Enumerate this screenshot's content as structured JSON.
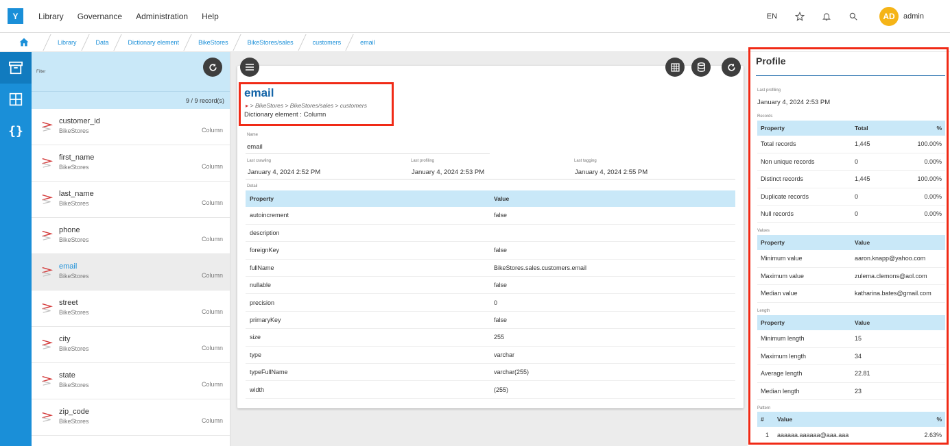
{
  "topbar": {
    "logo": "Y",
    "menu": [
      "Library",
      "Governance",
      "Administration",
      "Help"
    ],
    "lang": "EN",
    "avatar_initials": "AD",
    "username": "admin"
  },
  "breadcrumb": [
    "Library",
    "Data",
    "Dictionary element",
    "BikeStores",
    "BikeStores/sales",
    "customers",
    "email"
  ],
  "list": {
    "filter_label": "Filter",
    "count": "9 / 9 record(s)",
    "items": [
      {
        "name": "customer_id",
        "sub": "BikeStores",
        "type": "Column"
      },
      {
        "name": "first_name",
        "sub": "BikeStores",
        "type": "Column"
      },
      {
        "name": "last_name",
        "sub": "BikeStores",
        "type": "Column"
      },
      {
        "name": "phone",
        "sub": "BikeStores",
        "type": "Column"
      },
      {
        "name": "email",
        "sub": "BikeStores",
        "type": "Column"
      },
      {
        "name": "street",
        "sub": "BikeStores",
        "type": "Column"
      },
      {
        "name": "city",
        "sub": "BikeStores",
        "type": "Column"
      },
      {
        "name": "state",
        "sub": "BikeStores",
        "type": "Column"
      },
      {
        "name": "zip_code",
        "sub": "BikeStores",
        "type": "Column"
      }
    ]
  },
  "detail": {
    "title": "email",
    "path": "> BikeStores > BikeStores/sales > customers",
    "element_type": "Dictionary element : Column",
    "name_label": "Name",
    "name_value": "email",
    "last_crawling_label": "Last crawling",
    "last_crawling": "January 4, 2024 2:52 PM",
    "last_profiling_label": "Last profiling",
    "last_profiling": "January 4, 2024 2:53 PM",
    "last_tagging_label": "Last tagging",
    "last_tagging": "January 4, 2024 2:55 PM",
    "detail_label": "Detail",
    "col_property": "Property",
    "col_value": "Value",
    "rows": [
      [
        "autoincrement",
        "false"
      ],
      [
        "description",
        ""
      ],
      [
        "foreignKey",
        "false"
      ],
      [
        "fullName",
        "BikeStores.sales.customers.email"
      ],
      [
        "nullable",
        "false"
      ],
      [
        "precision",
        "0"
      ],
      [
        "primaryKey",
        "false"
      ],
      [
        "size",
        "255"
      ],
      [
        "type",
        "varchar"
      ],
      [
        "typeFullName",
        "varchar(255)"
      ],
      [
        "width",
        "(255)"
      ]
    ]
  },
  "profile": {
    "title": "Profile",
    "last_profiling_label": "Last profiling",
    "last_profiling": "January 4, 2024 2:53 PM",
    "records_label": "Records",
    "records_cols": [
      "Property",
      "Total",
      "%"
    ],
    "records": [
      [
        "Total records",
        "1,445",
        "100.00%"
      ],
      [
        "Non unique records",
        "0",
        "0.00%"
      ],
      [
        "Distinct records",
        "1,445",
        "100.00%"
      ],
      [
        "Duplicate records",
        "0",
        "0.00%"
      ],
      [
        "Null records",
        "0",
        "0.00%"
      ]
    ],
    "values_label": "Values",
    "values_cols": [
      "Property",
      "Value"
    ],
    "values": [
      [
        "Minimum value",
        "aaron.knapp@yahoo.com"
      ],
      [
        "Maximum value",
        "zulema.clemons@aol.com"
      ],
      [
        "Median value",
        "katharina.bates@gmail.com"
      ]
    ],
    "length_label": "Length",
    "length_cols": [
      "Property",
      "Value"
    ],
    "length": [
      [
        "Minimum length",
        "15"
      ],
      [
        "Maximum length",
        "34"
      ],
      [
        "Average length",
        "22.81"
      ],
      [
        "Median length",
        "23"
      ]
    ],
    "pattern_label": "Pattern",
    "pattern_cols": [
      "#",
      "Value",
      "%"
    ],
    "pattern": [
      [
        "1",
        "aaaaaa.aaaaaa@aaa.aaa",
        "2.63%"
      ]
    ]
  },
  "colors": {
    "accent": "#1a8fd8",
    "highlight": "#f02a16",
    "table_header": "#c9e8f8"
  }
}
